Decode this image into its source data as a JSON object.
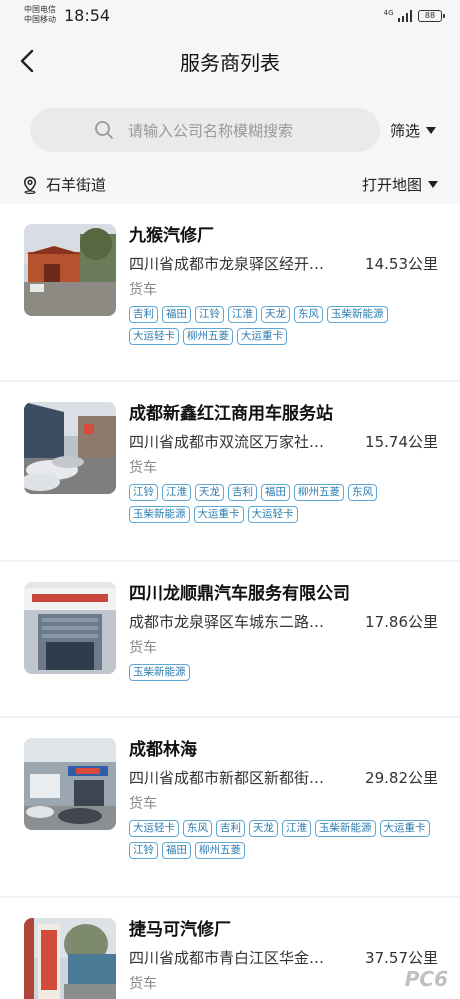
{
  "status_bar": {
    "carrier_1": "中国电信",
    "carrier_2": "中国移动",
    "time": "18:54",
    "network": "4G",
    "battery": "88"
  },
  "header": {
    "title": "服务商列表",
    "back_icon": "chevron-left-icon"
  },
  "search": {
    "placeholder": "请输入公司名称模糊搜索",
    "filter_label": "筛选"
  },
  "location": {
    "street": "石羊街道",
    "map_label": "打开地图"
  },
  "providers": [
    {
      "name": "九猴汽修厂",
      "address": "四川省成都市龙泉驿区经开…",
      "distance": "14.53公里",
      "type": "货车",
      "tags": [
        "吉利",
        "福田",
        "江铃",
        "江淮",
        "天龙",
        "东风",
        "玉柴新能源",
        "大运轻卡",
        "柳州五菱",
        "大运重卡"
      ]
    },
    {
      "name": "成都新鑫红江商用车服务站",
      "address": "四川省成都市双流区万家社…",
      "distance": "15.74公里",
      "type": "货车",
      "tags": [
        "江铃",
        "江淮",
        "天龙",
        "吉利",
        "福田",
        "柳州五菱",
        "东风",
        "玉柴新能源",
        "大运重卡",
        "大运轻卡"
      ]
    },
    {
      "name": "四川龙顺鼎汽车服务有限公司",
      "address": "成都市龙泉驿区车城东二路…",
      "distance": "17.86公里",
      "type": "货车",
      "tags": [
        "玉柴新能源"
      ]
    },
    {
      "name": "成都林海",
      "address": "四川省成都市新都区新都街…",
      "distance": "29.82公里",
      "type": "货车",
      "tags": [
        "大运轻卡",
        "东风",
        "吉利",
        "天龙",
        "江淮",
        "玉柴新能源",
        "大运重卡",
        "江铃",
        "福田",
        "柳州五菱"
      ]
    },
    {
      "name": "捷马可汽修厂",
      "address": "四川省成都市青白江区华金…",
      "distance": "37.57公里",
      "type": "货车",
      "tags": []
    }
  ],
  "watermark": "PC6"
}
